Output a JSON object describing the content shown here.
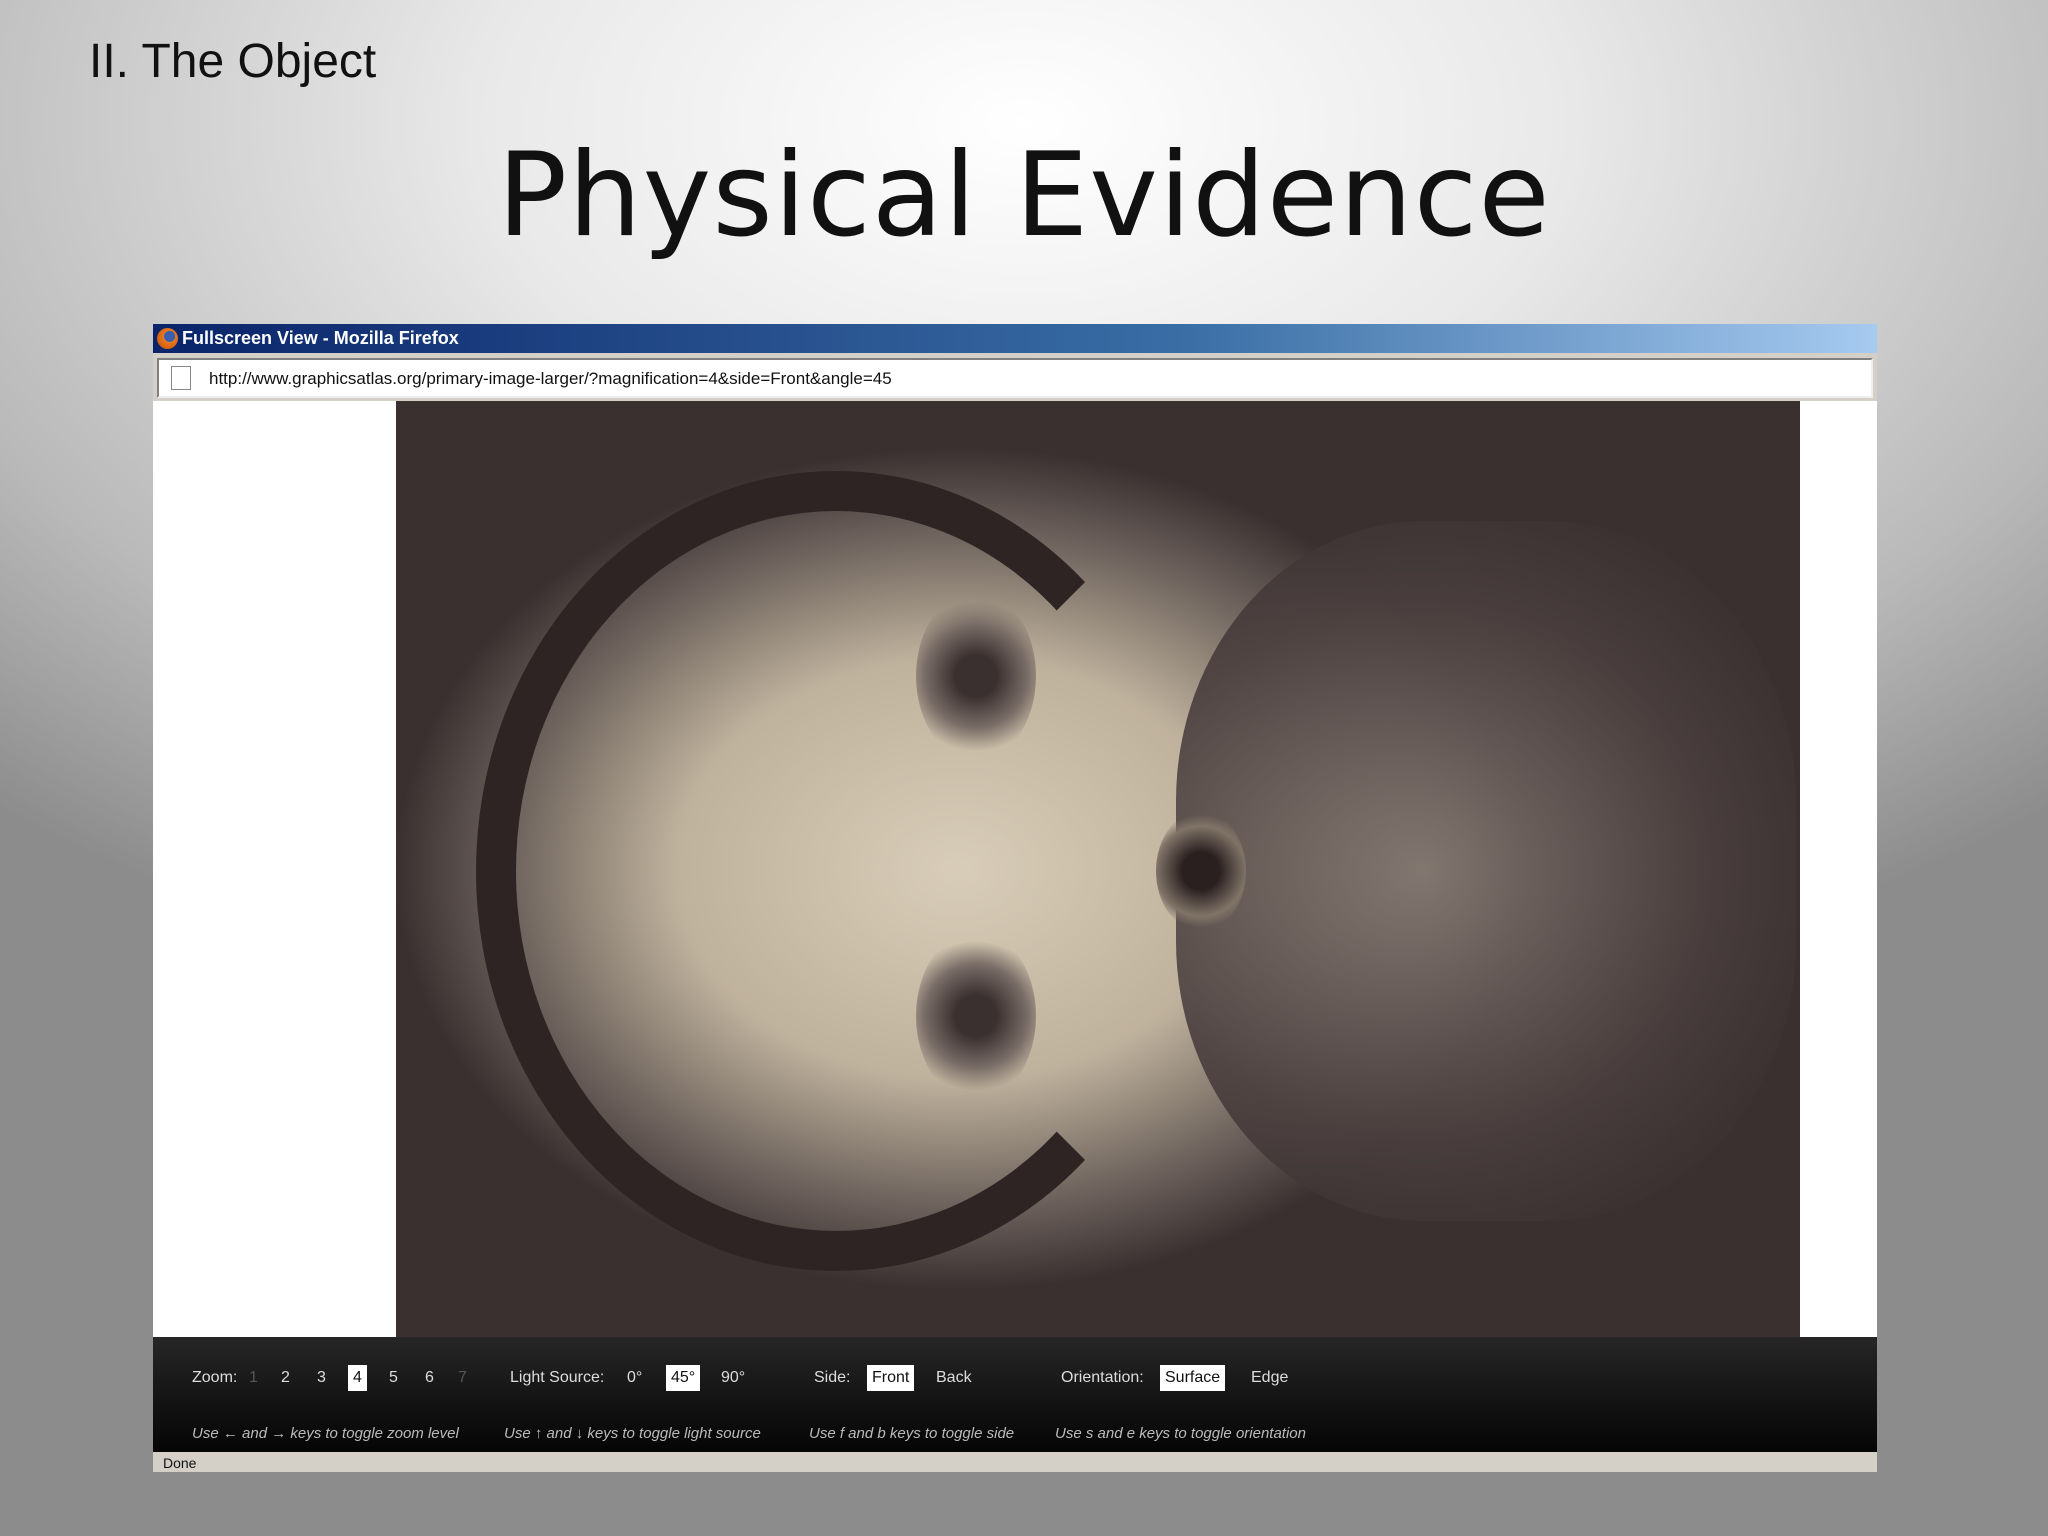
{
  "slide": {
    "section": "II. The Object",
    "title": "Physical Evidence"
  },
  "window": {
    "title": "Fullscreen View - Mozilla Firefox",
    "url": "http://www.graphicsatlas.org/primary-image-larger/?magnification=4&side=Front&angle=45",
    "status": "Done"
  },
  "controls": {
    "zoom_label": "Zoom:",
    "zoom_levels": [
      "1",
      "2",
      "3",
      "4",
      "5",
      "6",
      "7"
    ],
    "zoom_selected": "4",
    "light_label": "Light Source:",
    "light_options": [
      "0°",
      "45°",
      "90°"
    ],
    "light_selected": "45°",
    "side_label": "Side:",
    "side_options": [
      "Front",
      "Back"
    ],
    "side_selected": "Front",
    "orientation_label": "Orientation:",
    "orientation_options": [
      "Surface",
      "Edge"
    ],
    "orientation_selected": "Surface"
  },
  "hints": {
    "zoom": "Use ← and → keys to toggle zoom level",
    "light": "Use ↑ and ↓ keys to toggle light source",
    "side": "Use f and b keys to toggle side",
    "orientation": "Use s and e keys to toggle orientation"
  }
}
